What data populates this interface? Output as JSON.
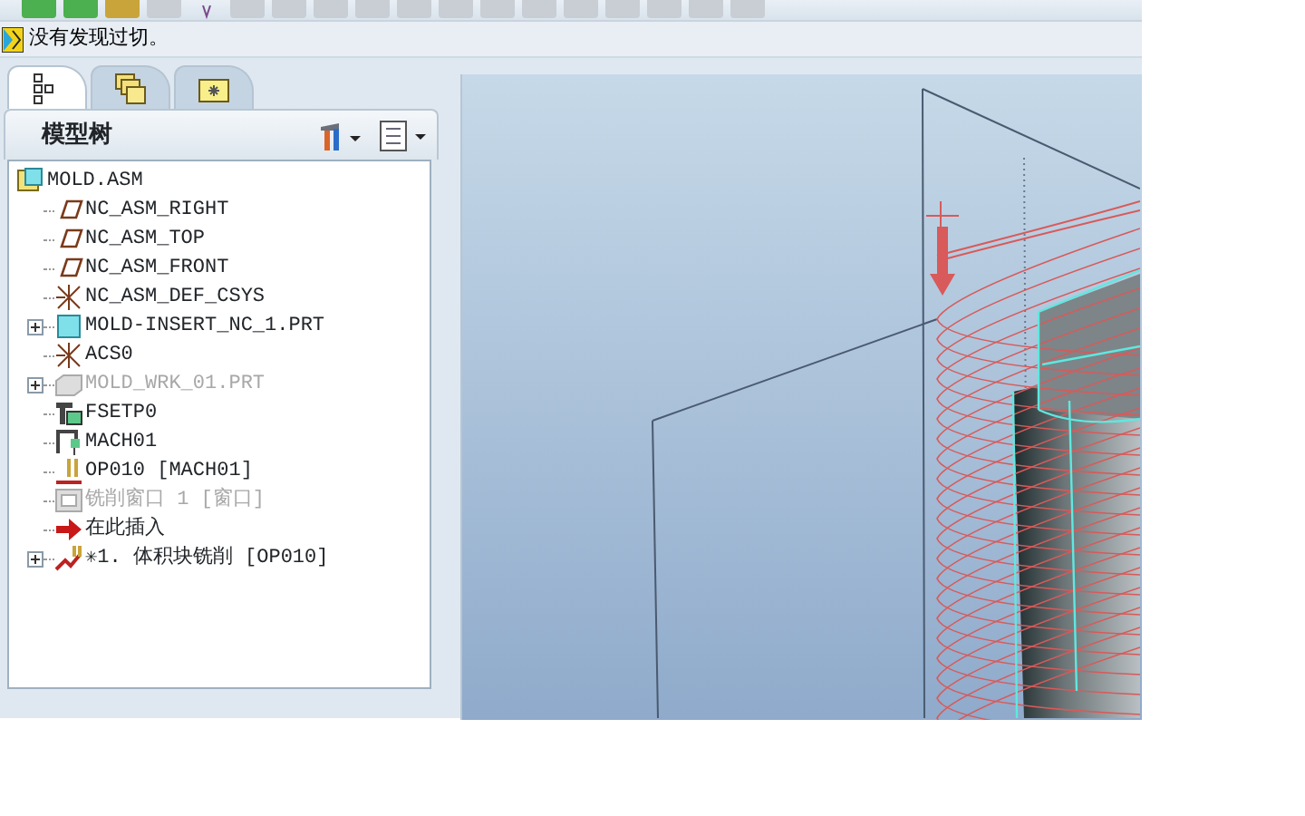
{
  "toolbar": {
    "buttons": [
      {
        "kind": "green"
      },
      {
        "kind": "green"
      },
      {
        "kind": "measure"
      },
      {
        "kind": "grey"
      },
      {
        "kind": "pointer"
      },
      {
        "kind": "grey"
      },
      {
        "kind": "grey"
      },
      {
        "kind": "grey"
      },
      {
        "kind": "grey"
      },
      {
        "kind": "grey"
      },
      {
        "kind": "grey"
      },
      {
        "kind": "grey"
      },
      {
        "kind": "grey"
      },
      {
        "kind": "grey"
      },
      {
        "kind": "grey"
      },
      {
        "kind": "grey"
      },
      {
        "kind": "grey"
      },
      {
        "kind": "grey"
      }
    ]
  },
  "message": {
    "text": "没有发现过切。"
  },
  "panel_tabs": [
    {
      "kind": "tree",
      "selected": true
    },
    {
      "kind": "folders",
      "selected": false
    },
    {
      "kind": "favorites",
      "selected": false
    }
  ],
  "model_tree": {
    "title": "模型树",
    "root": {
      "label": "MOLD.ASM",
      "kind": "asm",
      "disabled": false,
      "collapsed": false,
      "children": [
        {
          "label": "NC_ASM_RIGHT",
          "kind": "plane",
          "disabled": false,
          "collapsed": false
        },
        {
          "label": "NC_ASM_TOP",
          "kind": "plane",
          "disabled": false,
          "collapsed": false
        },
        {
          "label": "NC_ASM_FRONT",
          "kind": "plane",
          "disabled": false,
          "collapsed": false
        },
        {
          "label": "NC_ASM_DEF_CSYS",
          "kind": "csys",
          "disabled": false,
          "collapsed": false
        },
        {
          "label": "MOLD-INSERT_NC_1.PRT",
          "kind": "part",
          "disabled": false,
          "collapsed": true
        },
        {
          "label": "ACS0",
          "kind": "csys",
          "disabled": false,
          "collapsed": false
        },
        {
          "label": "MOLD_WRK_01.PRT",
          "kind": "workpiece",
          "disabled": true,
          "collapsed": true
        },
        {
          "label": "FSETP0",
          "kind": "fixture",
          "disabled": false,
          "collapsed": false
        },
        {
          "label": "MACH01",
          "kind": "machine",
          "disabled": false,
          "collapsed": false
        },
        {
          "label": "OP010 [MACH01]",
          "kind": "operation",
          "disabled": false,
          "collapsed": false
        },
        {
          "label": "铣削窗口 1 [窗口]",
          "kind": "window",
          "disabled": true,
          "collapsed": false
        },
        {
          "label": "在此插入",
          "kind": "insert",
          "disabled": false,
          "collapsed": false
        },
        {
          "label": "✳1. 体积块铣削 [OP010]",
          "kind": "sequence",
          "disabled": false,
          "collapsed": true
        }
      ]
    }
  }
}
